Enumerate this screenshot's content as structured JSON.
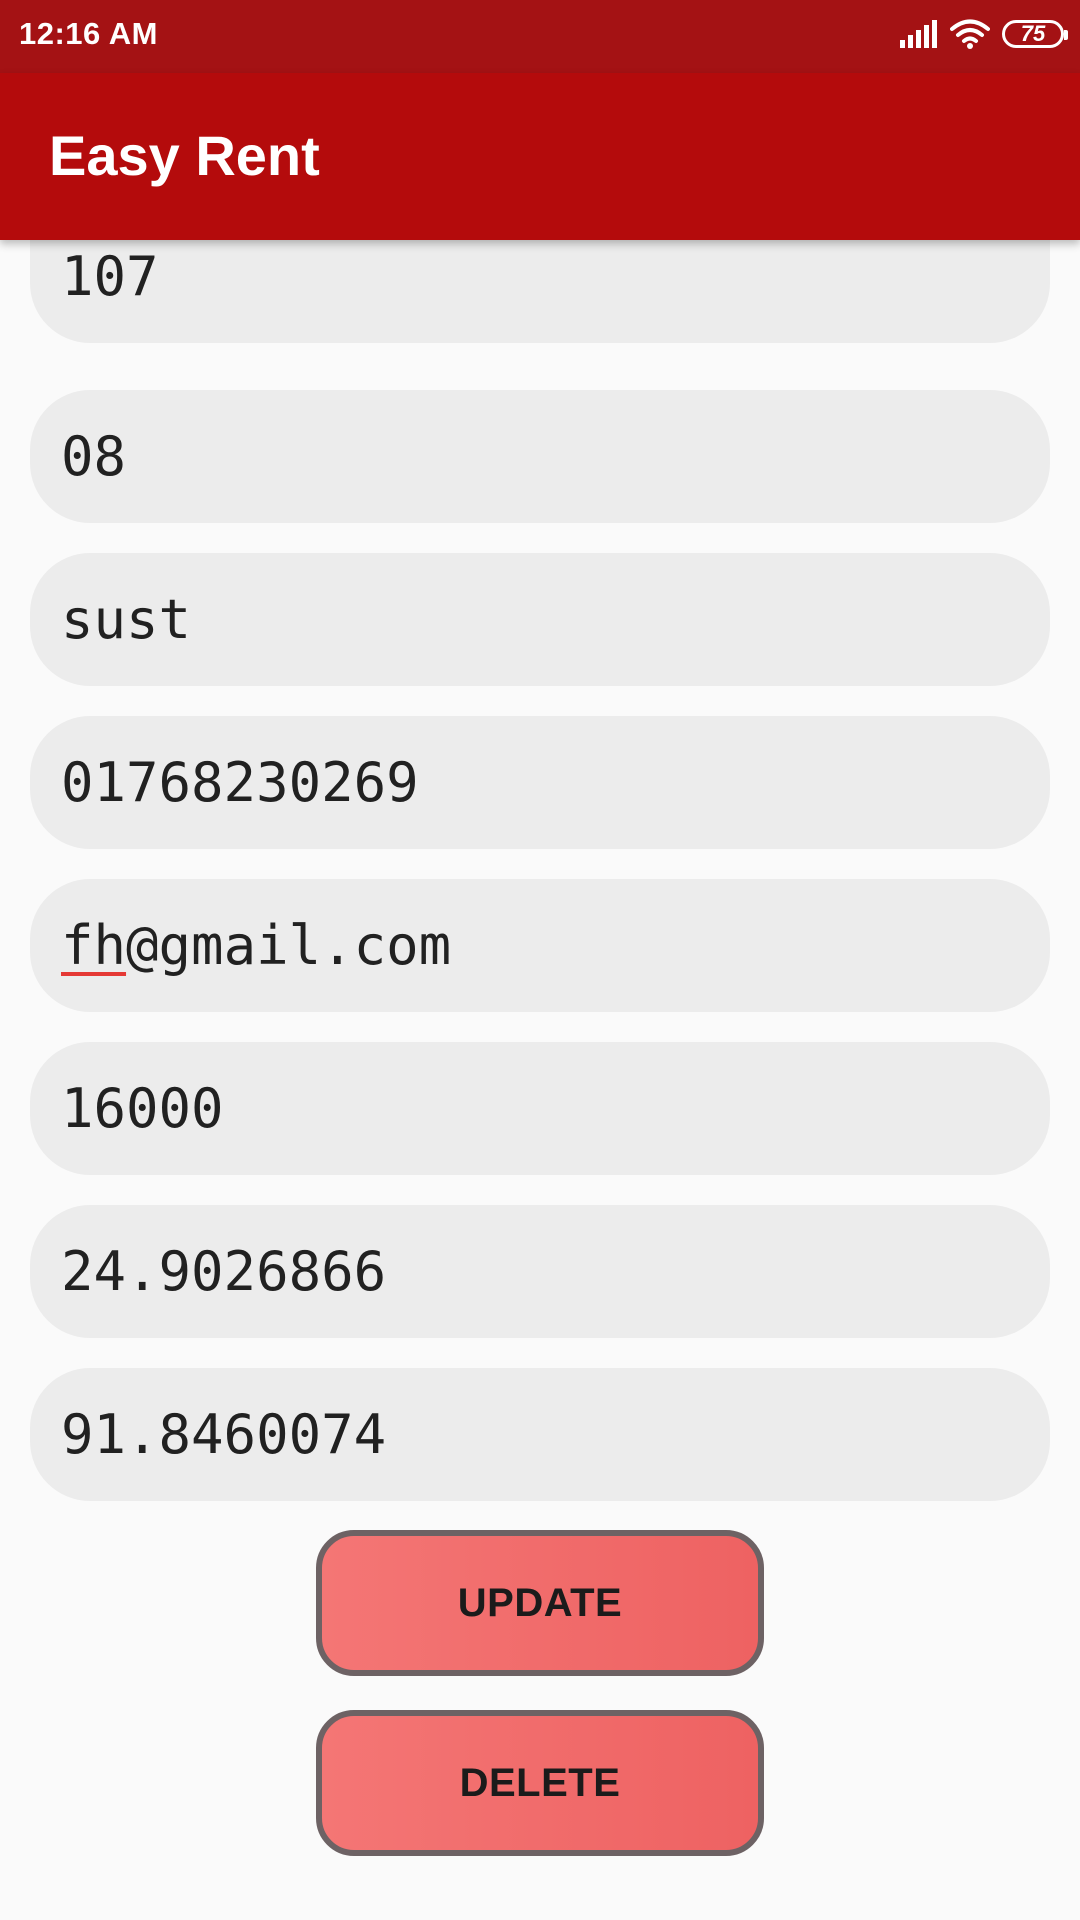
{
  "status_bar": {
    "time": "12:16 AM",
    "battery": "75",
    "icons": [
      "signal-icon",
      "wifi-icon",
      "battery-icon"
    ]
  },
  "app_bar": {
    "title": "Easy Rent"
  },
  "fields": [
    {
      "value": "107"
    },
    {
      "value": "08"
    },
    {
      "value": "sust"
    },
    {
      "value": "01768230269"
    },
    {
      "value_flagged": "fh",
      "value_rest": "@gmail.com"
    },
    {
      "value": "16000"
    },
    {
      "value": "24.9026866"
    },
    {
      "value": "91.8460074"
    }
  ],
  "buttons": {
    "update": "UPDATE",
    "delete": "DELETE"
  },
  "colors": {
    "status_bar": "#a41214",
    "app_bar": "#b40b0c",
    "field_bg": "#ececec",
    "button_fill": "#f06b6b",
    "button_border": "#6d6264"
  }
}
